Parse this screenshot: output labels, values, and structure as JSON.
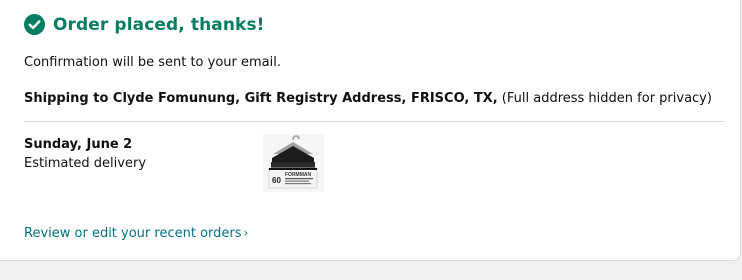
{
  "header": {
    "title": "Order placed, thanks!",
    "icon": "check-circle-icon",
    "accent_color": "#067d62"
  },
  "confirmation": {
    "text": "Confirmation will be sent to your email."
  },
  "shipping": {
    "label": "Shipping to Clyde Fomunung, Gift Registry Address, FRISCO, TX,",
    "note": "(Full address hidden for privacy)"
  },
  "delivery": {
    "date": "Sunday, June 2",
    "label": "Estimated delivery"
  },
  "product": {
    "thumbnail_icon": "hanger-box-product-image",
    "box_count": "60",
    "box_brand": "FORMMAN"
  },
  "review": {
    "link_label": "Review or edit your recent orders",
    "chevron": "›",
    "link_color": "#007185"
  }
}
